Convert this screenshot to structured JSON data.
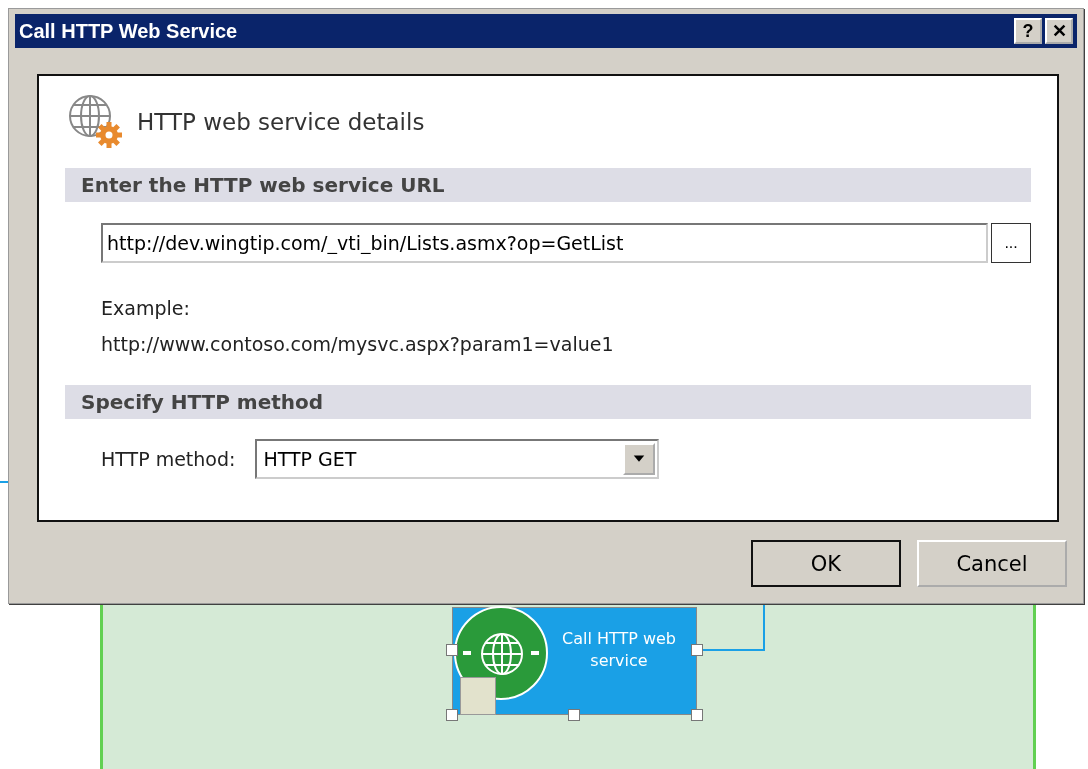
{
  "window": {
    "title": "Call HTTP Web Service",
    "title_buttons": [
      "?",
      "✕"
    ]
  },
  "header": {
    "title": "HTTP web service details"
  },
  "url_section": {
    "heading": "Enter the HTTP web service URL",
    "url": {
      "value": "http://dev.wingtip.com/_vti_bin/Lists.asmx?op=GetList"
    },
    "browse_button": "...",
    "example_label": "Example:",
    "example_url": "http://www.contoso.com/mysvc.aspx?param1=value1"
  },
  "method_section": {
    "heading": "Specify HTTP method",
    "label": "HTTP method:",
    "value": "HTTP GET"
  },
  "buttons": [
    "OK",
    "Cancel"
  ],
  "workflow_node": {
    "label": "Call HTTP web service"
  }
}
